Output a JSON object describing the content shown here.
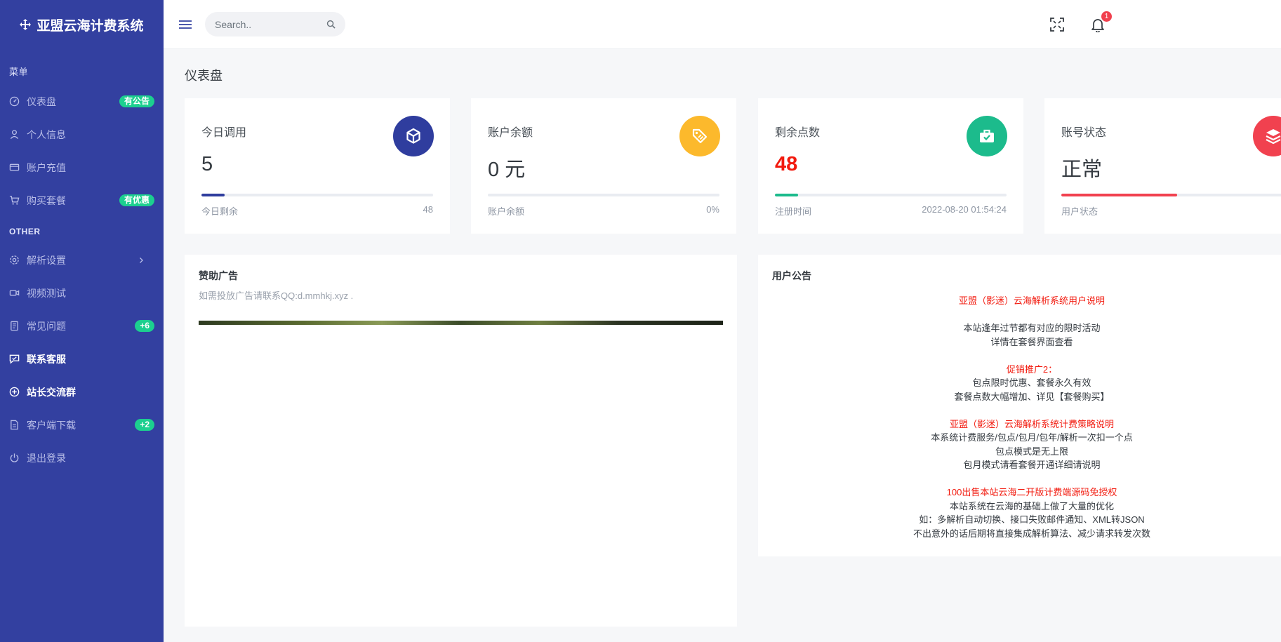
{
  "brand": {
    "title": "亚盟云海计费系统"
  },
  "sidebar": {
    "section_menu": "菜单",
    "section_other": "OTHER",
    "items": [
      {
        "label": "仪表盘",
        "icon": "dashboard-icon",
        "badge": "有公告"
      },
      {
        "label": "个人信息",
        "icon": "user-icon"
      },
      {
        "label": "账户充值",
        "icon": "credit-card-icon"
      },
      {
        "label": "购买套餐",
        "icon": "cart-icon",
        "badge": "有优惠"
      },
      {
        "label": "解析设置",
        "icon": "gear-icon"
      },
      {
        "label": "视频测试",
        "icon": "video-icon"
      },
      {
        "label": "常见问题",
        "icon": "document-icon",
        "badge": "+6"
      },
      {
        "label": "联系客服",
        "icon": "chat-icon"
      },
      {
        "label": "站长交流群",
        "icon": "plus-circle-icon"
      },
      {
        "label": "客户端下载",
        "icon": "file-icon",
        "badge": "+2"
      },
      {
        "label": "退出登录",
        "icon": "power-icon"
      }
    ]
  },
  "topbar": {
    "search_placeholder": "Search..",
    "notification_count": "1"
  },
  "page": {
    "title": "仪表盘"
  },
  "cards": [
    {
      "title": "今日调用",
      "value": "5",
      "foot_left": "今日剩余",
      "foot_right": "48",
      "progress": 0.1,
      "color": "#2f3d9e",
      "icon": "cube-icon"
    },
    {
      "title": "账户余额",
      "value": "0 元",
      "foot_left": "账户余额",
      "foot_right": "0%",
      "progress": 0,
      "color": "#fcb92c",
      "icon": "tag-icon"
    },
    {
      "title": "剩余点数",
      "value": "48",
      "foot_left": "注册时间",
      "foot_right": "2022-08-20 01:54:24",
      "progress": 0.1,
      "color": "#1cbb8c",
      "icon": "briefcase-check-icon"
    },
    {
      "title": "账号状态",
      "value": "正常",
      "foot_left": "用户状态",
      "foot_right": "",
      "progress": 0.5,
      "color": "#f1414f",
      "icon": "layers-icon"
    }
  ],
  "ad_panel": {
    "title": "赞助广告",
    "desc": "如需投放广告请联系QQ:d.mmhkj.xyz ."
  },
  "notice_panel": {
    "title": "用户公告",
    "lines": [
      {
        "text": "亚盟（影迷）云海解析系统用户说明",
        "red": true
      },
      {
        "text": ""
      },
      {
        "text": "本站逢年过节都有对应的限时活动"
      },
      {
        "text": "详情在套餐界面查看"
      },
      {
        "text": ""
      },
      {
        "text": "促销推广2：",
        "red": true
      },
      {
        "text": "包点限时优惠、套餐永久有效"
      },
      {
        "text": "套餐点数大幅增加、详见【套餐购买】"
      },
      {
        "text": ""
      },
      {
        "text": "亚盟（影迷）云海解析系统计费策略说明",
        "red": true
      },
      {
        "text": "本系统计费服务/包点/包月/包年/解析一次扣一个点"
      },
      {
        "text": "包点模式是无上限"
      },
      {
        "text": "包月模式请看套餐开通详细请说明"
      },
      {
        "text": ""
      },
      {
        "text": "100出售本站云海二开版计费端源码免授权",
        "red": true
      },
      {
        "text": "本站系统在云海的基础上做了大量的优化"
      },
      {
        "text": "如：多解析自动切换、接口失败邮件通知、XML转JSON"
      },
      {
        "text": "不出意外的话后期将直接集成解析算法、减少请求转发次数"
      }
    ]
  }
}
